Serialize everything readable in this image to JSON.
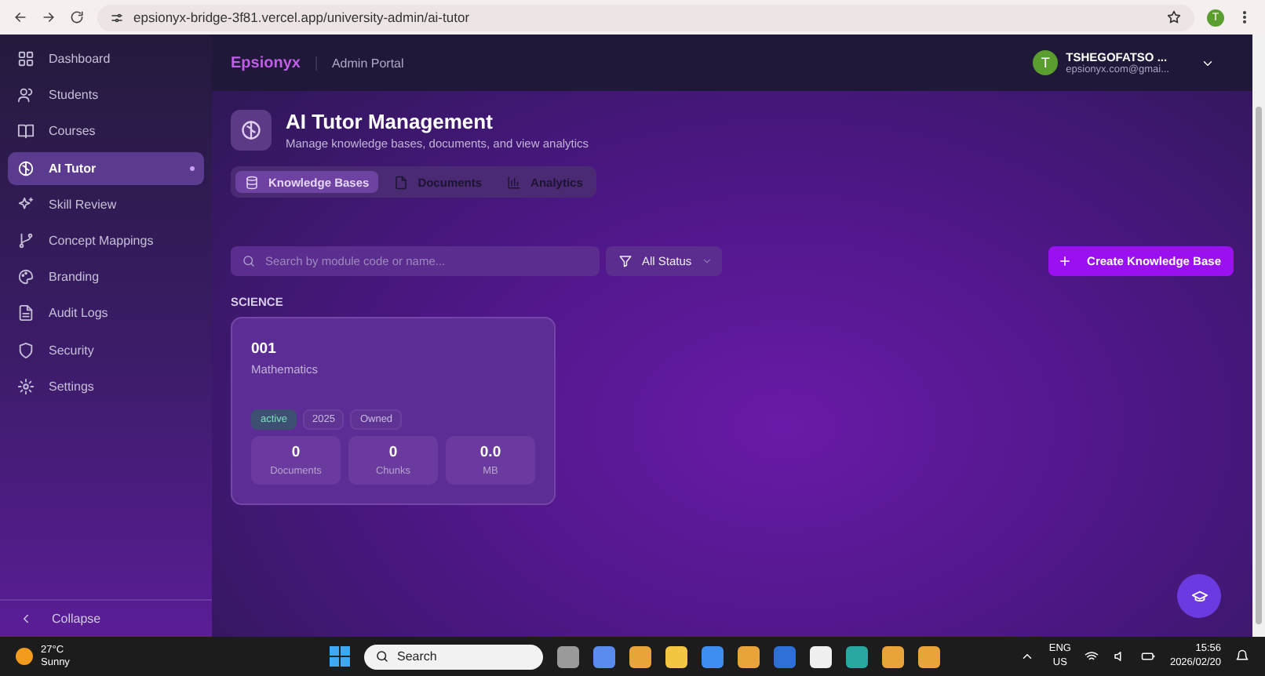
{
  "browser": {
    "url": "epsionyx-bridge-3f81.vercel.app/university-admin/ai-tutor",
    "profile_initial": "T"
  },
  "sidebar": {
    "items": [
      {
        "label": "Dashboard",
        "selected": false
      },
      {
        "label": "Students",
        "selected": false
      },
      {
        "label": "Courses",
        "selected": false
      },
      {
        "label": "AI Tutor",
        "selected": true
      },
      {
        "label": "Skill Review",
        "selected": false
      },
      {
        "label": "Concept Mappings",
        "selected": false
      },
      {
        "label": "Branding",
        "selected": false
      },
      {
        "label": "Audit Logs",
        "selected": false
      },
      {
        "label": "Security",
        "selected": false
      },
      {
        "label": "Settings",
        "selected": false
      }
    ],
    "collapse": "Collapse"
  },
  "header": {
    "brand": "Epsionyx",
    "portal": "Admin Portal",
    "user": {
      "initial": "T",
      "name": "TSHEGOFATSO ...",
      "email": "epsionyx.com@gmai..."
    }
  },
  "page": {
    "title": "AI Tutor Management",
    "subtitle": "Manage knowledge bases, documents, and view analytics",
    "tabs": [
      {
        "label": "Knowledge Bases",
        "selected": true
      },
      {
        "label": "Documents",
        "selected": false
      },
      {
        "label": "Analytics",
        "selected": false
      }
    ],
    "search": {
      "placeholder": "Search by module code or name..."
    },
    "filter": "All Status",
    "create_button": "Create Knowledge Base",
    "groups": [
      {
        "heading": "SCIENCE",
        "cards": [
          {
            "code": "001",
            "name": "Mathematics",
            "tags": [
              {
                "label": "active",
                "kind": "status"
              },
              {
                "label": "2025",
                "kind": "plain"
              },
              {
                "label": "Owned",
                "kind": "plain"
              }
            ],
            "stats": [
              {
                "value": "0",
                "label": "Documents"
              },
              {
                "value": "0",
                "label": "Chunks"
              },
              {
                "value": "0.0",
                "label": "MB"
              }
            ]
          }
        ]
      }
    ]
  },
  "taskbar": {
    "weather": {
      "temp": "27°C",
      "condition": "Sunny"
    },
    "search": "Search",
    "lang": "ENG",
    "region": "US",
    "time": "15:56",
    "date": "2026/02/20"
  }
}
